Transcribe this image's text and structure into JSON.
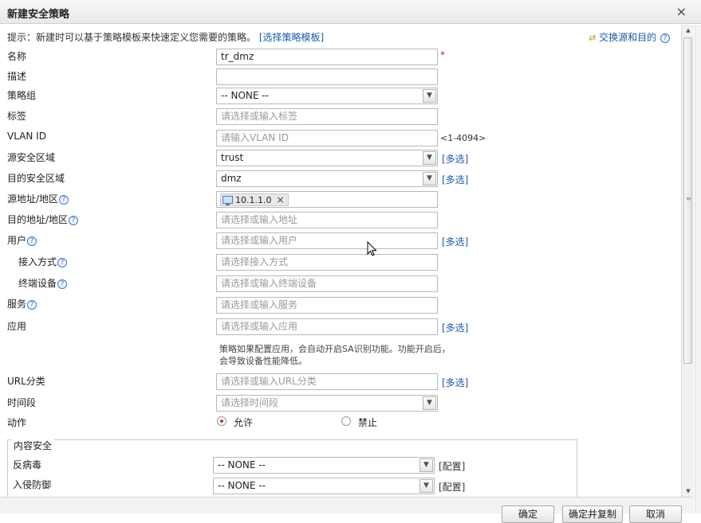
{
  "dialog": {
    "title": "新建安全策略",
    "close_label": "×"
  },
  "hint": {
    "text": "提示：新建时可以基于策略模板来快速定义您需要的策略。",
    "template_link": "[选择策略模板]",
    "swap_label": "交换源和目的"
  },
  "multi_select_label": "[多选]",
  "fields": {
    "name": {
      "label": "名称",
      "value": "tr_dmz",
      "required_mark": "*"
    },
    "description": {
      "label": "描述",
      "value": ""
    },
    "policy_group": {
      "label": "策略组",
      "value": "-- NONE --"
    },
    "tag": {
      "label": "标签",
      "placeholder": "请选择或输入标签"
    },
    "vlan": {
      "label": "VLAN ID",
      "placeholder": "请输入VLAN ID",
      "range": "<1-4094>"
    },
    "src_zone": {
      "label": "源安全区域",
      "value": "trust"
    },
    "dst_zone": {
      "label": "目的安全区域",
      "value": "dmz"
    },
    "src_addr": {
      "label": "源地址/地区",
      "tag_value": "10.1.1.0",
      "tag_remove": "×"
    },
    "dst_addr": {
      "label": "目的地址/地区",
      "placeholder": "请选择或输入地址"
    },
    "user": {
      "label": "用户",
      "placeholder": "请选择或输入用户"
    },
    "access_mode": {
      "label": "接入方式",
      "placeholder": "请选择接入方式"
    },
    "terminal": {
      "label": "终端设备",
      "placeholder": "请选择或输入终端设备"
    },
    "service": {
      "label": "服务",
      "placeholder": "请选择或输入服务"
    },
    "application": {
      "label": "应用",
      "placeholder": "请选择或输入应用",
      "note": "策略如果配置应用，会自动开启SA识别功能。功能开启后，会导致设备性能降低。"
    },
    "url_category": {
      "label": "URL分类",
      "placeholder": "请选择或输入URL分类"
    },
    "time_range": {
      "label": "时间段",
      "placeholder": "请选择时间段"
    },
    "action": {
      "label": "动作",
      "options": [
        "允许",
        "禁止"
      ],
      "selected": "允许"
    }
  },
  "content_security": {
    "legend": "内容安全",
    "config_label": "[配置]",
    "antivirus": {
      "label": "反病毒",
      "value": "-- NONE --"
    },
    "ips": {
      "label": "入侵防御",
      "value": "-- NONE --"
    }
  },
  "footer": {
    "buttons": [
      "确定",
      "确定并复制",
      "取消"
    ]
  },
  "colors": {
    "link": "#1a5aa8",
    "required": "#dd2222",
    "radio_selected": "#c0392b"
  }
}
